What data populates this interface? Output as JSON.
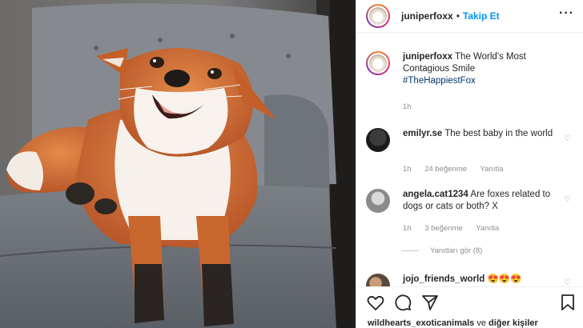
{
  "header": {
    "username": "juniperfoxx",
    "separator": "•",
    "follow_label": "Takip Et",
    "more_icon": "more-horizontal-icon"
  },
  "caption": {
    "username": "juniperfoxx",
    "text": "The World's Most Contagious Smile",
    "hashtag": "#TheHappiestFox",
    "time": "1h"
  },
  "comments": [
    {
      "username": "emilyr.se",
      "text": "The best baby in the world",
      "time": "1h",
      "likes": "24 beğenme",
      "reply": "Yanıtla"
    },
    {
      "username": "angela.cat1234",
      "text": "Are foxes related to dogs or cats or both? X",
      "time": "1h",
      "likes": "3 beğenme",
      "reply": "Yanıtla",
      "view_replies": "Yanıtları gör (8)"
    },
    {
      "username": "jojo_friends_world",
      "text": "😍😍😍"
    }
  ],
  "actions": [
    "heart-icon",
    "comment-icon",
    "share-icon",
    "bookmark-icon"
  ],
  "likes": {
    "names": "wildhearts_exoticanimals",
    "connector": "ve",
    "others": "diğer kişiler"
  },
  "colors": {
    "link": "#0095f6",
    "hashtag": "#00376b",
    "muted": "#8e8e8e",
    "fox": "#d9793a"
  }
}
